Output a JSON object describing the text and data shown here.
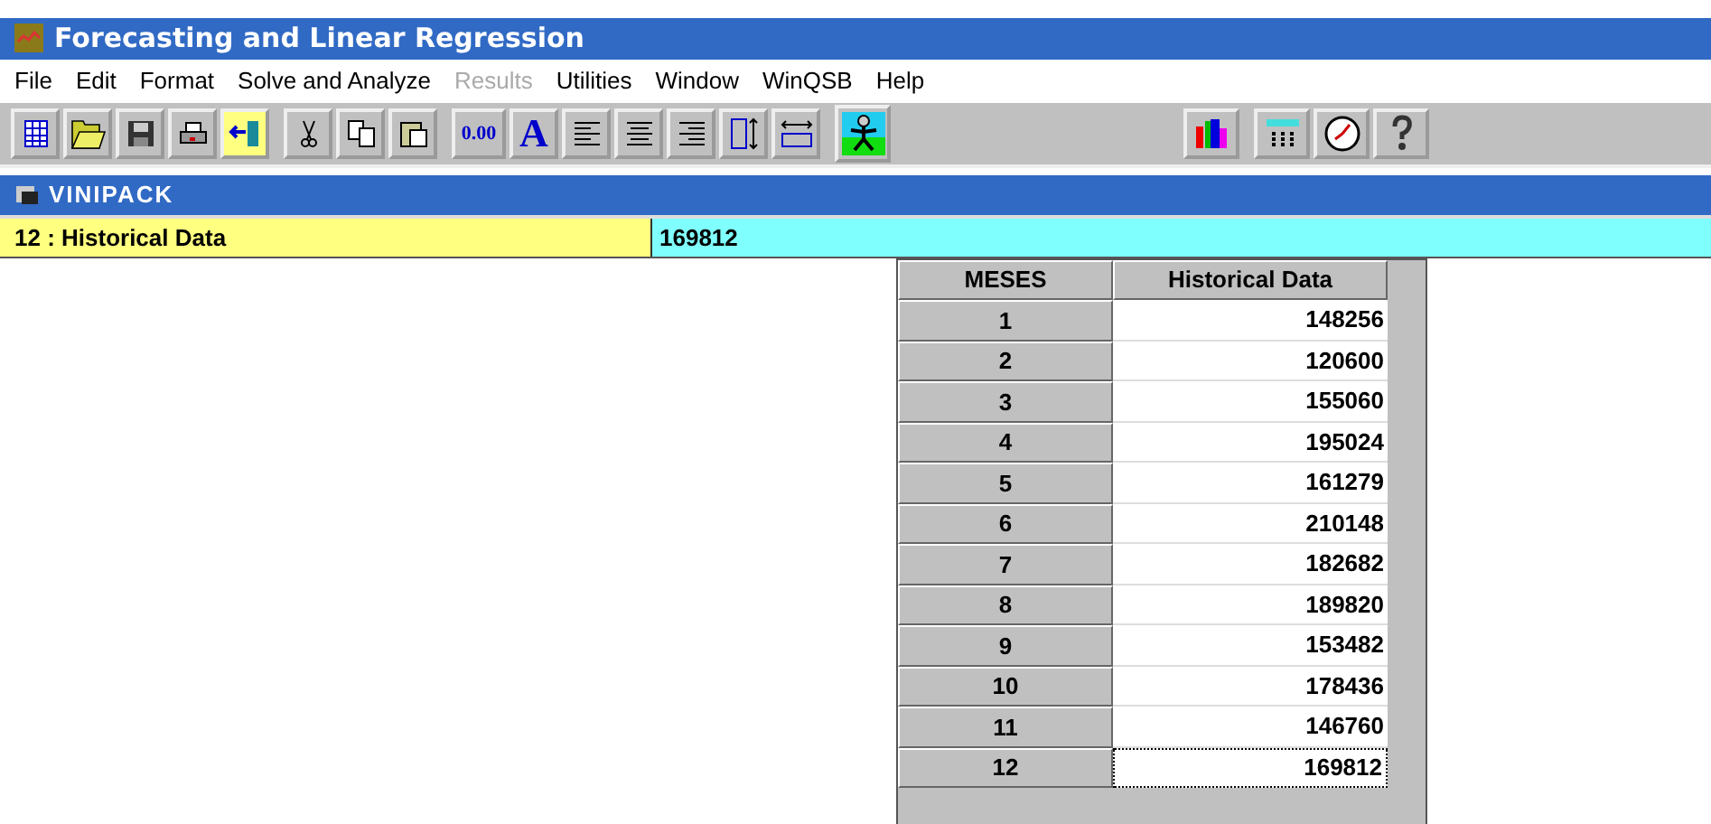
{
  "window": {
    "title": "Forecasting and Linear Regression"
  },
  "menu": [
    {
      "label": "File",
      "disabled": false
    },
    {
      "label": "Edit",
      "disabled": false
    },
    {
      "label": "Format",
      "disabled": false
    },
    {
      "label": "Solve and Analyze",
      "disabled": false
    },
    {
      "label": "Results",
      "disabled": true
    },
    {
      "label": "Utilities",
      "disabled": false
    },
    {
      "label": "Window",
      "disabled": false
    },
    {
      "label": "WinQSB",
      "disabled": false
    },
    {
      "label": "Help",
      "disabled": false
    }
  ],
  "toolbar": {
    "decimal_button": "0.00",
    "font_button": "A"
  },
  "document": {
    "title": "VINIPACK"
  },
  "cell_bar": {
    "label": "12 : Historical Data",
    "value": "169812"
  },
  "table": {
    "columns": [
      "MESES",
      "Historical Data"
    ],
    "rows": [
      {
        "month": "1",
        "value": "148256",
        "selected": false
      },
      {
        "month": "2",
        "value": "120600",
        "selected": false
      },
      {
        "month": "3",
        "value": "155060",
        "selected": false
      },
      {
        "month": "4",
        "value": "195024",
        "selected": false
      },
      {
        "month": "5",
        "value": "161279",
        "selected": false
      },
      {
        "month": "6",
        "value": "210148",
        "selected": false
      },
      {
        "month": "7",
        "value": "182682",
        "selected": false
      },
      {
        "month": "8",
        "value": "189820",
        "selected": false
      },
      {
        "month": "9",
        "value": "153482",
        "selected": false
      },
      {
        "month": "10",
        "value": "178436",
        "selected": false
      },
      {
        "month": "11",
        "value": "146760",
        "selected": false
      },
      {
        "month": "12",
        "value": "169812",
        "selected": true
      }
    ]
  }
}
